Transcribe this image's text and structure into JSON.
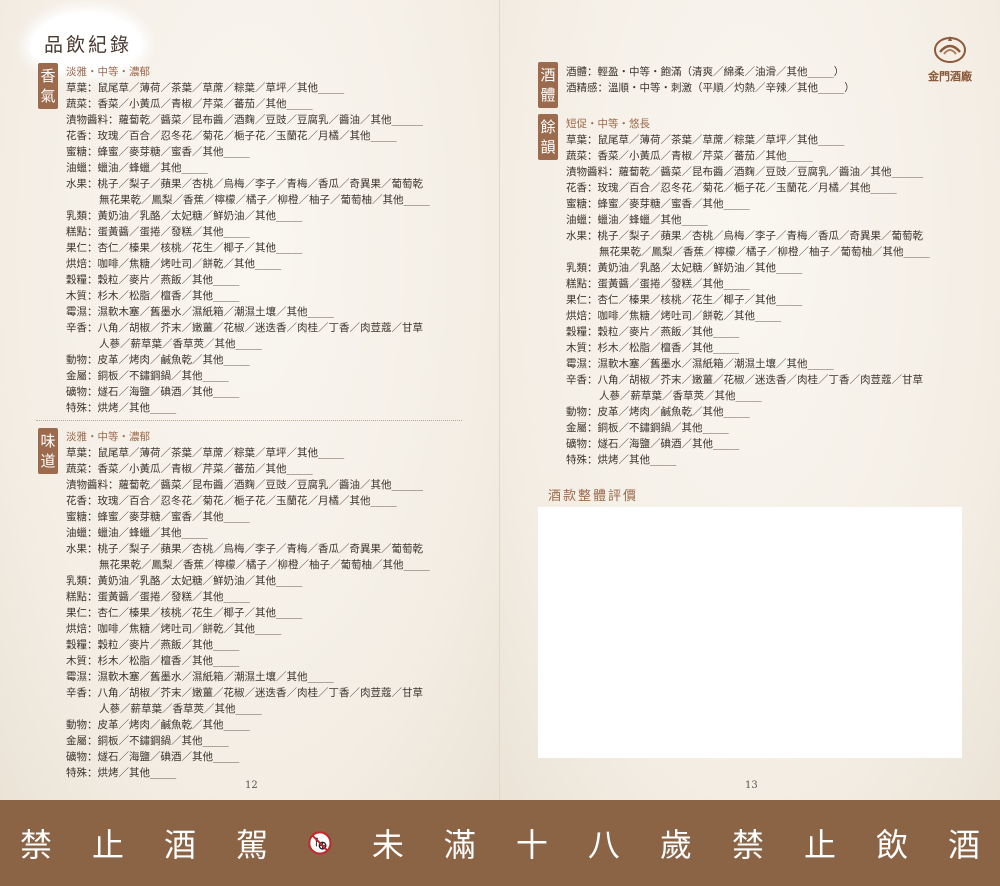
{
  "title": "品飲紀錄",
  "left_page": {
    "aroma": {
      "tag": "香氣",
      "heading": "淡雅・中等・濃郁",
      "rows": [
        {
          "k": "草葉：",
          "v": "鼠尾草／薄荷／茶葉／草蓆／粽葉／草坪／其他_____"
        },
        {
          "k": "蔬菜：",
          "v": "香菜／小黃瓜／青椒／芹菜／蕃茄／其他_____"
        },
        {
          "k": "漬物醬料：",
          "v": "蘿蔔乾／醬菜／昆布醬／酒麴／豆豉／豆腐乳／醬油／其他______"
        },
        {
          "k": "花香：",
          "v": "玫瑰／百合／忍冬花／菊花／梔子花／玉蘭花／月橘／其他_____"
        },
        {
          "k": "蜜糖：",
          "v": "蜂蜜／麥芽糖／蜜香／其他_____"
        },
        {
          "k": "油蠟：",
          "v": "蠟油／蜂蠟／其他_____"
        },
        {
          "k": "水果：",
          "v": "桃子／梨子／蘋果／杏桃／烏梅／李子／青梅／香瓜／奇異果／葡萄乾",
          "cont": "無花果乾／鳳梨／香蕉／檸檬／橘子／柳橙／柚子／葡萄柚／其他_____"
        },
        {
          "k": "乳類：",
          "v": "黃奶油／乳酪／太妃糖／鮮奶油／其他_____"
        },
        {
          "k": "糕點：",
          "v": "蛋黃醬／蛋捲／發糕／其他_____"
        },
        {
          "k": "果仁：",
          "v": "杏仁／榛果／核桃／花生／椰子／其他_____"
        },
        {
          "k": "烘焙：",
          "v": "咖啡／焦糖／烤吐司／餅乾／其他_____"
        },
        {
          "k": "穀糧：",
          "v": "穀粒／麥片／燕飯／其他_____"
        },
        {
          "k": "木質：",
          "v": "杉木／松脂／檀香／其他_____"
        },
        {
          "k": "霉濕：",
          "v": "濕軟木塞／舊墨水／濕紙箱／潮濕土壤／其他_____"
        },
        {
          "k": "辛香：",
          "v": "八角／胡椒／芥末／嫩薑／花椒／迷迭香／肉桂／丁香／肉荳蔻／甘草",
          "cont": "人蔘／薪草葉／香草莢／其他_____"
        },
        {
          "k": "動物：",
          "v": "皮革／烤肉／鹹魚乾／其他_____"
        },
        {
          "k": "金屬：",
          "v": "銅板／不鏽鋼鍋／其他_____"
        },
        {
          "k": "礦物：",
          "v": "燧石／海鹽／碘酒／其他_____"
        },
        {
          "k": "特殊：",
          "v": "烘烤／其他_____"
        }
      ]
    },
    "taste": {
      "tag": "味道",
      "heading": "淡雅・中等・濃郁",
      "rows": [
        {
          "k": "草葉：",
          "v": "鼠尾草／薄荷／茶葉／草蓆／粽葉／草坪／其他_____"
        },
        {
          "k": "蔬菜：",
          "v": "香菜／小黃瓜／青椒／芹菜／蕃茄／其他_____"
        },
        {
          "k": "漬物醬料：",
          "v": "蘿蔔乾／醬菜／昆布醬／酒麴／豆豉／豆腐乳／醬油／其他______"
        },
        {
          "k": "花香：",
          "v": "玫瑰／百合／忍冬花／菊花／梔子花／玉蘭花／月橘／其他_____"
        },
        {
          "k": "蜜糖：",
          "v": "蜂蜜／麥芽糖／蜜香／其他_____"
        },
        {
          "k": "油蠟：",
          "v": "蠟油／蜂蠟／其他_____"
        },
        {
          "k": "水果：",
          "v": "桃子／梨子／蘋果／杏桃／烏梅／李子／青梅／香瓜／奇異果／葡萄乾",
          "cont": "無花果乾／鳳梨／香蕉／檸檬／橘子／柳橙／柚子／葡萄柚／其他_____"
        },
        {
          "k": "乳類：",
          "v": "黃奶油／乳酪／太妃糖／鮮奶油／其他_____"
        },
        {
          "k": "糕點：",
          "v": "蛋黃醬／蛋捲／發糕／其他_____"
        },
        {
          "k": "果仁：",
          "v": "杏仁／榛果／核桃／花生／椰子／其他_____"
        },
        {
          "k": "烘焙：",
          "v": "咖啡／焦糖／烤吐司／餅乾／其他_____"
        },
        {
          "k": "穀糧：",
          "v": "穀粒／麥片／燕飯／其他_____"
        },
        {
          "k": "木質：",
          "v": "杉木／松脂／檀香／其他_____"
        },
        {
          "k": "霉濕：",
          "v": "濕軟木塞／舊墨水／濕紙箱／潮濕土壤／其他_____"
        },
        {
          "k": "辛香：",
          "v": "八角／胡椒／芥末／嫩薑／花椒／迷迭香／肉桂／丁香／肉荳蔻／甘草",
          "cont": "人蔘／薪草葉／香草莢／其他_____"
        },
        {
          "k": "動物：",
          "v": "皮革／烤肉／鹹魚乾／其他_____"
        },
        {
          "k": "金屬：",
          "v": "銅板／不鏽鋼鍋／其他_____"
        },
        {
          "k": "礦物：",
          "v": "燧石／海鹽／碘酒／其他_____"
        },
        {
          "k": "特殊：",
          "v": "烘烤／其他_____"
        }
      ]
    },
    "page_number": "12"
  },
  "right_page": {
    "logo_text": "金門酒廠",
    "body": {
      "tag": "酒體",
      "rows": [
        {
          "k": "酒體：",
          "v": "輕盈・中等・飽滿（清爽／綿柔／油滑／其他_____）"
        },
        {
          "k": "酒精感：",
          "v": "溫順・中等・刺激（平順／灼熱／辛辣／其他_____）"
        }
      ]
    },
    "finish": {
      "tag": "餘韻",
      "heading": "短促・中等・悠長",
      "rows": [
        {
          "k": "草葉：",
          "v": "鼠尾草／薄荷／茶葉／草蓆／粽葉／草坪／其他_____"
        },
        {
          "k": "蔬菜：",
          "v": "香菜／小黃瓜／青椒／芹菜／蕃茄／其他_____"
        },
        {
          "k": "漬物醬料：",
          "v": "蘿蔔乾／醬菜／昆布醬／酒麴／豆豉／豆腐乳／醬油／其他______"
        },
        {
          "k": "花香：",
          "v": "玫瑰／百合／忍冬花／菊花／梔子花／玉蘭花／月橘／其他_____"
        },
        {
          "k": "蜜糖：",
          "v": "蜂蜜／麥芽糖／蜜香／其他_____"
        },
        {
          "k": "油蠟：",
          "v": "蠟油／蜂蠟／其他_____"
        },
        {
          "k": "水果：",
          "v": "桃子／梨子／蘋果／杏桃／烏梅／李子／青梅／香瓜／奇異果／葡萄乾",
          "cont": "無花果乾／鳳梨／香蕉／檸檬／橘子／柳橙／柚子／葡萄柚／其他_____"
        },
        {
          "k": "乳類：",
          "v": "黃奶油／乳酪／太妃糖／鮮奶油／其他_____"
        },
        {
          "k": "糕點：",
          "v": "蛋黃醬／蛋捲／發糕／其他_____"
        },
        {
          "k": "果仁：",
          "v": "杏仁／榛果／核桃／花生／椰子／其他_____"
        },
        {
          "k": "烘焙：",
          "v": "咖啡／焦糖／烤吐司／餅乾／其他_____"
        },
        {
          "k": "穀糧：",
          "v": "穀粒／麥片／燕飯／其他_____"
        },
        {
          "k": "木質：",
          "v": "杉木／松脂／檀香／其他_____"
        },
        {
          "k": "霉濕：",
          "v": "濕軟木塞／舊墨水／濕紙箱／潮濕土壤／其他_____"
        },
        {
          "k": "辛香：",
          "v": "八角／胡椒／芥末／嫩薑／花椒／迷迭香／肉桂／丁香／肉荳蔻／甘草",
          "cont": "人蔘／薪草葉／香草莢／其他_____"
        },
        {
          "k": "動物：",
          "v": "皮革／烤肉／鹹魚乾／其他_____"
        },
        {
          "k": "金屬：",
          "v": "銅板／不鏽鋼鍋／其他_____"
        },
        {
          "k": "礦物：",
          "v": "燧石／海鹽／碘酒／其他_____"
        },
        {
          "k": "特殊：",
          "v": "烘烤／其他_____"
        }
      ]
    },
    "eval_title": "酒款整體評價",
    "page_number": "13"
  },
  "footer": {
    "left": [
      "禁",
      "止",
      "酒",
      "駕"
    ],
    "icon": "no-drinking-driving-icon",
    "right": [
      "未",
      "滿",
      "十",
      "八",
      "歲",
      "禁",
      "止",
      "飲",
      "酒"
    ]
  },
  "colors": {
    "accent": "#9c6a4c",
    "footer": "#8b6345"
  }
}
